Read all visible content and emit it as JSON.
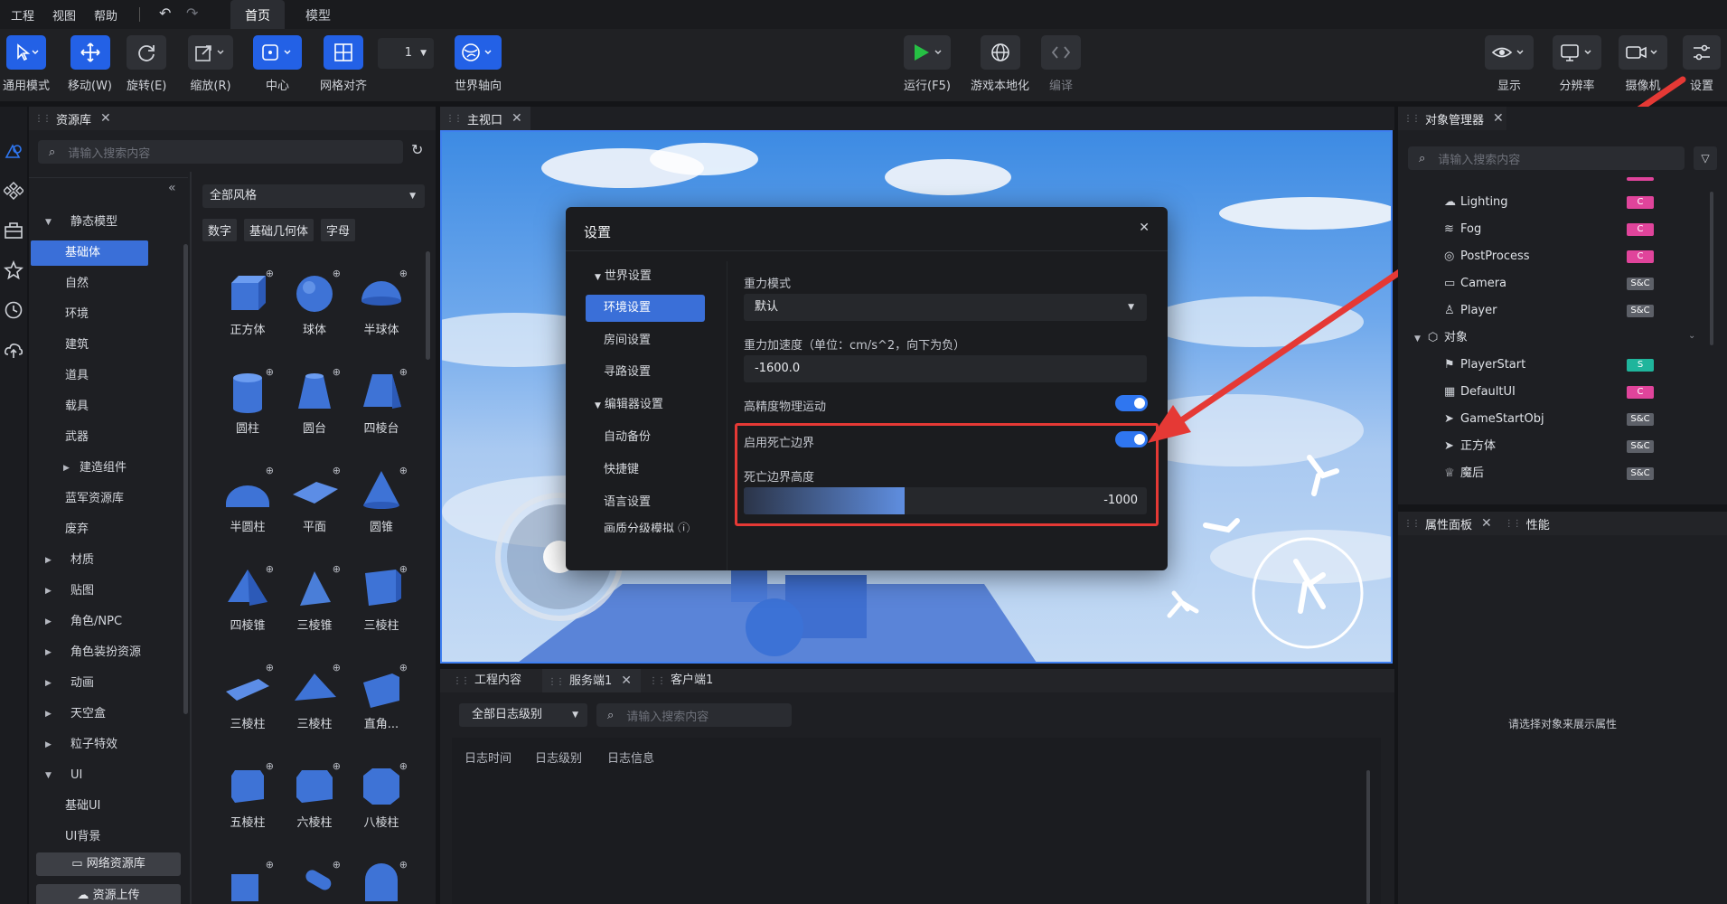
{
  "menu": [
    "工程",
    "视图",
    "帮助"
  ],
  "top_tabs": [
    {
      "label": "首页",
      "active": true
    },
    {
      "label": "模型",
      "active": false
    }
  ],
  "toolbar": {
    "general_mode": "通用模式",
    "move": "移动(W)",
    "rotate": "旋转(E)",
    "scale": "缩放(R)",
    "center": "中心",
    "grid_align": "网格对齐",
    "grid_value": "1",
    "world_axis": "世界轴向",
    "run": "运行(F5)",
    "localization": "游戏本地化",
    "compile": "编译",
    "display": "显示",
    "resolution": "分辨率",
    "camera": "摄像机",
    "settings": "设置"
  },
  "asset_panel": {
    "title": "资源库",
    "search_placeholder": "请输入搜索内容",
    "style_select": "全部风格",
    "filter_tags": [
      "数字",
      "基础几何体",
      "字母"
    ],
    "tree": [
      {
        "label": "静态模型",
        "arrow": "▼",
        "level": 0
      },
      {
        "label": "基础体",
        "arrow": "",
        "level": 1,
        "selected": true
      },
      {
        "label": "自然",
        "arrow": "",
        "level": 1
      },
      {
        "label": "环境",
        "arrow": "",
        "level": 1
      },
      {
        "label": "建筑",
        "arrow": "",
        "level": 1
      },
      {
        "label": "道具",
        "arrow": "",
        "level": 1
      },
      {
        "label": "载具",
        "arrow": "",
        "level": 1
      },
      {
        "label": "武器",
        "arrow": "",
        "level": 1
      },
      {
        "label": "建造组件",
        "arrow": "▶",
        "level": 1
      },
      {
        "label": "蓝军资源库",
        "arrow": "",
        "level": 1
      },
      {
        "label": "废弃",
        "arrow": "",
        "level": 1
      },
      {
        "label": "材质",
        "arrow": "▶",
        "level": 0
      },
      {
        "label": "贴图",
        "arrow": "▶",
        "level": 0
      },
      {
        "label": "角色/NPC",
        "arrow": "▶",
        "level": 0
      },
      {
        "label": "角色装扮资源",
        "arrow": "▶",
        "level": 0
      },
      {
        "label": "动画",
        "arrow": "▶",
        "level": 0
      },
      {
        "label": "天空盒",
        "arrow": "▶",
        "level": 0
      },
      {
        "label": "粒子特效",
        "arrow": "▶",
        "level": 0
      },
      {
        "label": "UI",
        "arrow": "▼",
        "level": 0
      },
      {
        "label": "基础UI",
        "arrow": "",
        "level": 1
      },
      {
        "label": "UI背景",
        "arrow": "",
        "level": 1
      }
    ],
    "network_button": "网络资源库",
    "upload_button": "资源上传",
    "assets": [
      "正方体",
      "球体",
      "半球体",
      "圆柱",
      "圆台",
      "四棱台",
      "半圆柱",
      "平面",
      "圆锥",
      "四棱锥",
      "三棱锥",
      "三棱柱",
      "三棱柱",
      "三棱柱",
      "直角...",
      "五棱柱",
      "六棱柱",
      "八棱柱",
      "",
      "",
      ""
    ]
  },
  "viewport": {
    "title": "主视口"
  },
  "settings_dialog": {
    "title": "设置",
    "nav": [
      {
        "label": "世界设置",
        "group": true
      },
      {
        "label": "环境设置",
        "selected": true
      },
      {
        "label": "房间设置"
      },
      {
        "label": "寻路设置"
      },
      {
        "label": "编辑器设置",
        "group": true
      },
      {
        "label": "自动备份"
      },
      {
        "label": "快捷键"
      },
      {
        "label": "语言设置"
      },
      {
        "label": "画质分级模拟 ⓘ"
      }
    ],
    "gravity_mode_label": "重力模式",
    "gravity_mode_value": "默认",
    "gravity_accel_label": "重力加速度（单位：cm/s^2，向下为负）",
    "gravity_accel_value": "-1600.0",
    "high_precision_label": "高精度物理运动",
    "death_boundary_label": "启用死亡边界",
    "death_height_label": "死亡边界高度",
    "death_height_value": "-1000",
    "death_height_fill": 0.4
  },
  "object_panel": {
    "title": "对象管理器",
    "search_placeholder": "请输入搜索内容",
    "rows": [
      {
        "name": "Lighting",
        "badge": "C",
        "type": "c"
      },
      {
        "name": "Fog",
        "badge": "C",
        "type": "c"
      },
      {
        "name": "PostProcess",
        "badge": "C",
        "type": "c"
      },
      {
        "name": "Camera",
        "badge": "S&C",
        "type": "sc"
      },
      {
        "name": "Player",
        "badge": "S&C",
        "type": "sc"
      },
      {
        "name": "对象",
        "badge": "",
        "type": "group"
      },
      {
        "name": "PlayerStart",
        "badge": "S",
        "type": "s"
      },
      {
        "name": "DefaultUI",
        "badge": "C",
        "type": "c"
      },
      {
        "name": "GameStartObj",
        "badge": "S&C",
        "type": "sc"
      },
      {
        "name": "正方体",
        "badge": "S&C",
        "type": "sc"
      },
      {
        "name": "魔后",
        "badge": "S&C",
        "type": "sc"
      }
    ]
  },
  "property_panel": {
    "title": "属性面板",
    "perf_tab": "性能",
    "empty_text": "请选择对象来展示属性"
  },
  "bottom_panel": {
    "tabs": [
      "工程内容",
      "服务端1",
      "客户端1"
    ],
    "log_level": "全部日志级别",
    "search_placeholder": "请输入搜索内容",
    "columns": [
      "日志时间",
      "日志级别",
      "日志信息"
    ]
  },
  "colors": {
    "accent": "#2361e6",
    "highlight_red": "#e53935",
    "badge_c": "#e0449b",
    "badge_s": "#1fb59c"
  }
}
